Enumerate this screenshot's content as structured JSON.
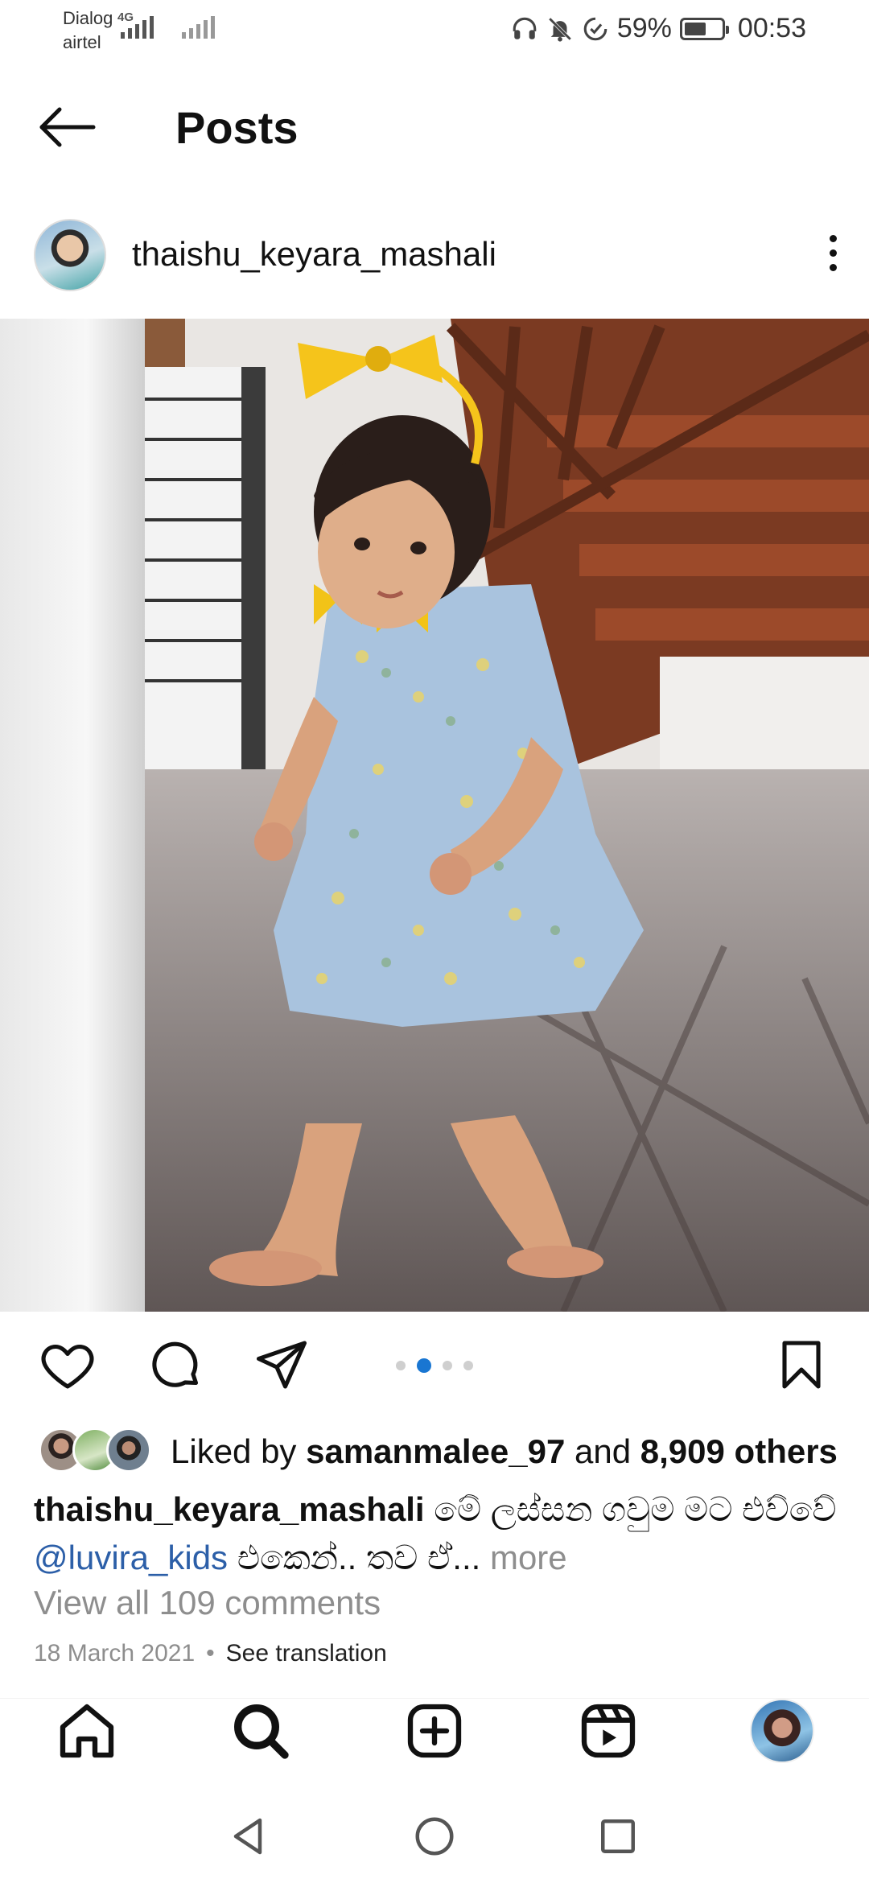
{
  "status_bar": {
    "carrier_1": "Dialog",
    "carrier_2": "airtel",
    "network_type": "4G",
    "battery_percent": "59%",
    "battery_level": 0.59,
    "time": "00:53",
    "icons": [
      "headphones-icon",
      "mute-icon",
      "data-saver-icon",
      "battery-icon"
    ]
  },
  "header": {
    "title": "Posts",
    "back_icon": "arrow-left-icon"
  },
  "post": {
    "username": "thaishu_keyara_mashali",
    "menu_icon": "more-vertical-icon",
    "image_alt": "photo",
    "carousel": {
      "count": 4,
      "active_index": 1
    },
    "actions": [
      "heart-icon",
      "comment-icon",
      "send-icon",
      "bookmark-icon"
    ],
    "likes": {
      "prefix": "Liked by ",
      "user": "samanmalee_97",
      "middle": " and ",
      "count": "8,909 others"
    },
    "caption": {
      "user": "thaishu_keyara_mashali",
      "text_1": " මේ ලස්සන ගවුම මට එව්වේ ",
      "mention": "@luvira_kids",
      "text_2": "  එකෙන්.. තව ඒ...",
      "more": " more"
    },
    "view_comments": "View all 109 comments",
    "date": "18 March 2021",
    "separator": "•",
    "see_translation": "See translation"
  },
  "bottom_nav": {
    "items": [
      "home-icon",
      "search-icon",
      "create-icon",
      "reels-icon",
      "profile-avatar"
    ]
  },
  "system_nav": {
    "items": [
      "back-triangle-icon",
      "home-circle-icon",
      "recents-square-icon"
    ]
  }
}
